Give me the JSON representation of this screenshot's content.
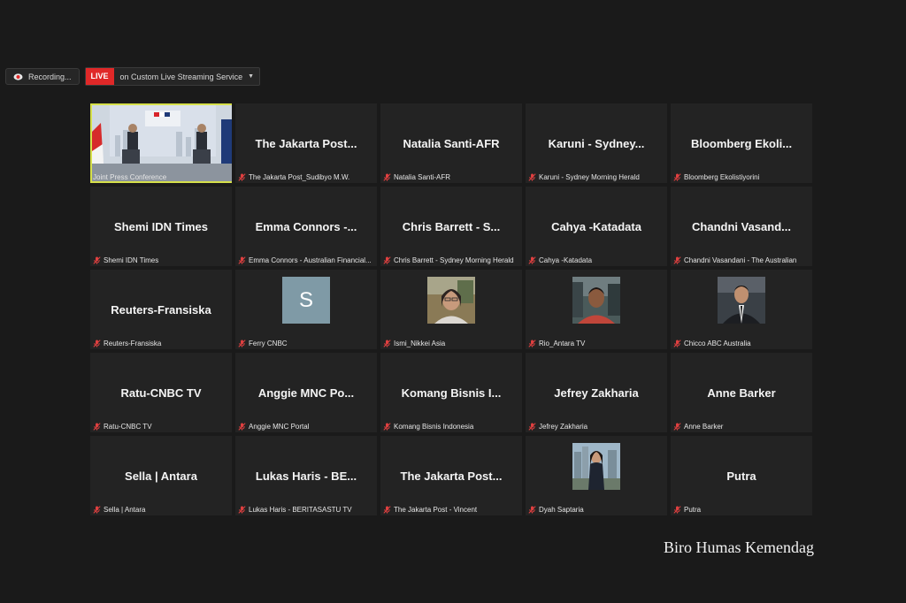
{
  "toolbar": {
    "recording_label": "Recording...",
    "live_badge": "LIVE",
    "live_service": "on Custom Live Streaming Service",
    "dropdown_caret": "▼"
  },
  "tiles": [
    {
      "name": "",
      "label": "Joint Press Conference",
      "type": "video",
      "active": true,
      "muted": false
    },
    {
      "name": "The Jakarta Post...",
      "label": "The Jakarta Post_Sudibyo M.W.",
      "type": "name"
    },
    {
      "name": "Natalia Santi-AFR",
      "label": "Natalia Santi-AFR",
      "type": "name"
    },
    {
      "name": "Karuni - Sydney...",
      "label": "Karuni - Sydney Morning Herald",
      "type": "name"
    },
    {
      "name": "Bloomberg Ekoli...",
      "label": "Bloomberg Ekolistiyorini",
      "type": "name"
    },
    {
      "name": "Shemi IDN Times",
      "label": "Shemi IDN Times",
      "type": "name"
    },
    {
      "name": "Emma Connors -...",
      "label": "Emma Connors - Australian Financial...",
      "type": "name"
    },
    {
      "name": "Chris Barrett - S...",
      "label": "Chris Barrett - Sydney Morning Herald",
      "type": "name"
    },
    {
      "name": "Cahya -Katadata",
      "label": "Cahya -Katadata",
      "type": "name"
    },
    {
      "name": "Chandni Vasand...",
      "label": "Chandni Vasandani - The Australian",
      "type": "name"
    },
    {
      "name": "Reuters-Fransiska",
      "label": "Reuters-Fransiska",
      "type": "name"
    },
    {
      "name": "",
      "label": "Ferry CNBC",
      "type": "letter",
      "letter": "S"
    },
    {
      "name": "",
      "label": "Ismi_Nikkei Asia",
      "type": "photo",
      "photo": "woman-glasses"
    },
    {
      "name": "",
      "label": "Rio_Antara TV",
      "type": "photo",
      "photo": "man-outdoor"
    },
    {
      "name": "",
      "label": "Chicco ABC Australia",
      "type": "photo",
      "photo": "man-suit"
    },
    {
      "name": "Ratu-CNBC TV",
      "label": "Ratu-CNBC TV",
      "type": "name"
    },
    {
      "name": "Anggie MNC Po...",
      "label": "Anggie MNC Portal",
      "type": "name"
    },
    {
      "name": "Komang Bisnis I...",
      "label": "Komang Bisnis Indonesia",
      "type": "name"
    },
    {
      "name": "Jefrey Zakharia",
      "label": "Jefrey Zakharia",
      "type": "name"
    },
    {
      "name": "Anne Barker",
      "label": "Anne Barker",
      "type": "name"
    },
    {
      "name": "Sella | Antara",
      "label": "Sella | Antara",
      "type": "name"
    },
    {
      "name": "Lukas Haris - BE...",
      "label": "Lukas Haris - BERITASASTU TV",
      "type": "name"
    },
    {
      "name": "The Jakarta Post...",
      "label": "The Jakarta Post - Vincent",
      "type": "name"
    },
    {
      "name": "",
      "label": "Dyah Saptaria",
      "type": "photo",
      "photo": "woman-city"
    },
    {
      "name": "Putra",
      "label": "Putra",
      "type": "name"
    }
  ],
  "watermark": "Biro Humas Kemendag",
  "colors": {
    "background": "#1a1a1a",
    "tile": "#232323",
    "active_border": "#d6e04a",
    "live": "#e02828",
    "muted_mic": "#e04040"
  }
}
